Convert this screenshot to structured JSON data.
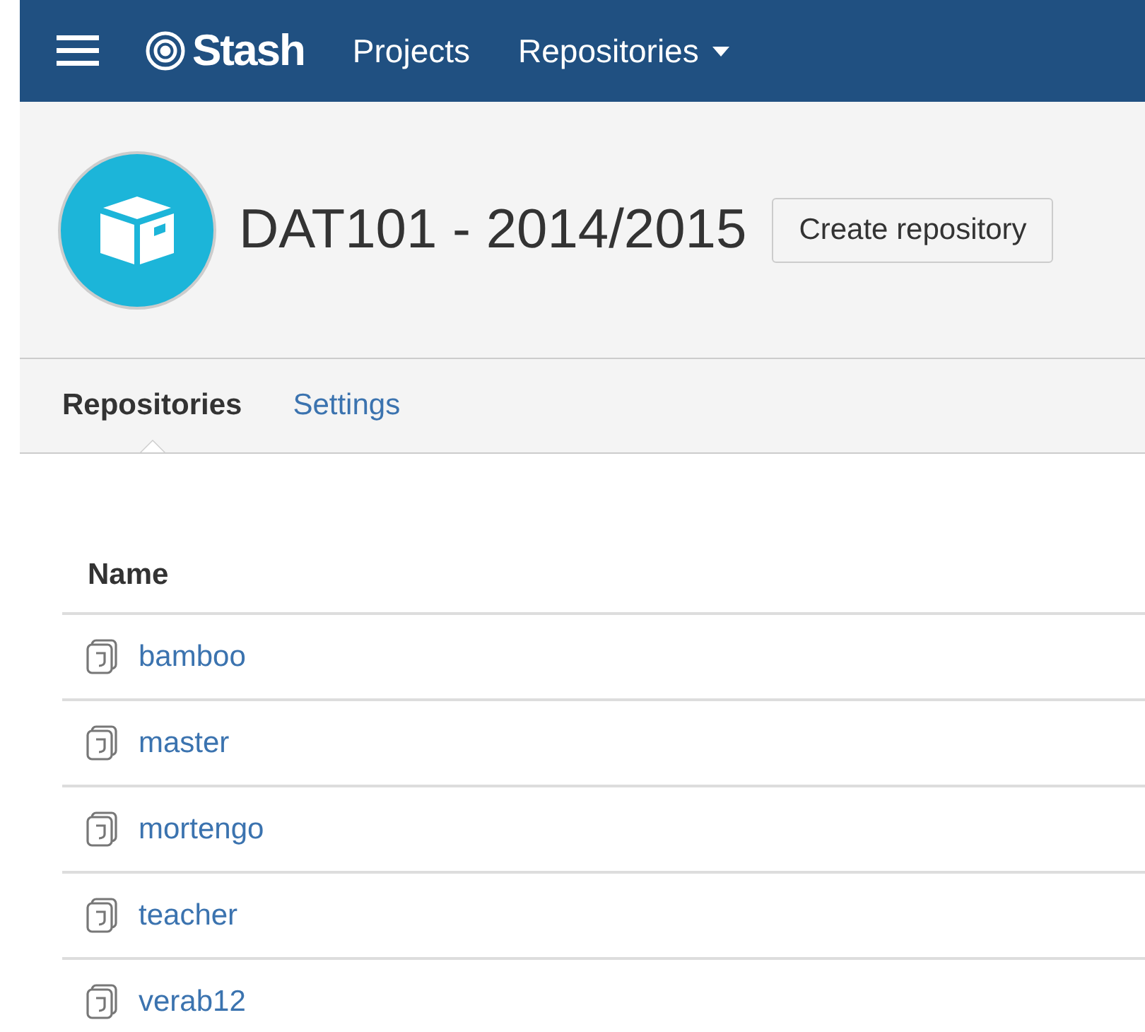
{
  "nav": {
    "logo": "Stash",
    "links": [
      {
        "label": "Projects",
        "dropdown": false
      },
      {
        "label": "Repositories",
        "dropdown": true
      }
    ]
  },
  "project": {
    "title": "DAT101 - 2014/2015",
    "action": "Create repository"
  },
  "tabs": [
    {
      "label": "Repositories",
      "selected": true
    },
    {
      "label": "Settings",
      "selected": false
    }
  ],
  "table": {
    "columns": [
      "Name"
    ],
    "rows": [
      {
        "name": "bamboo"
      },
      {
        "name": "master"
      },
      {
        "name": "mortengo"
      },
      {
        "name": "teacher"
      },
      {
        "name": "verab12"
      }
    ]
  }
}
